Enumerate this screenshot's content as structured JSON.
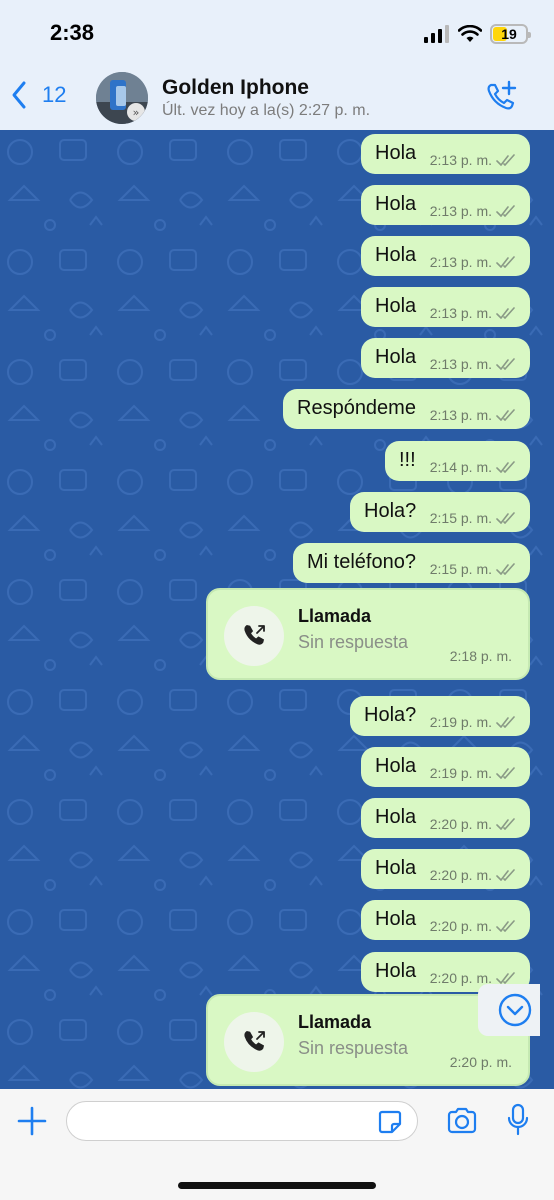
{
  "status_bar": {
    "time": "2:38",
    "battery": "19",
    "icons": [
      "signal-icon",
      "wifi-icon",
      "battery-icon"
    ]
  },
  "header": {
    "back_count": "12",
    "contact_name": "Golden Iphone",
    "contact_status": "Últ. vez hoy a la(s) 2:27 p. m.",
    "accent_color": "#1e7ef0"
  },
  "messages": [
    {
      "text": "Hola",
      "time": "2:13 p. m."
    },
    {
      "text": "Hola",
      "time": "2:13 p. m."
    },
    {
      "text": "Hola",
      "time": "2:13 p. m."
    },
    {
      "text": "Hola",
      "time": "2:13 p. m."
    },
    {
      "text": "Hola",
      "time": "2:13 p. m."
    },
    {
      "text": "Respóndeme",
      "time": "2:13 p. m."
    },
    {
      "text": "!!!",
      "time": "2:14 p. m."
    },
    {
      "text": "Hola?",
      "time": "2:15 p. m."
    },
    {
      "text": "Mi teléfono?",
      "time": "2:15 p. m."
    },
    {
      "call": true,
      "title": "Llamada",
      "subtitle": "Sin respuesta",
      "time": "2:18 p. m."
    },
    {
      "text": "Hola?",
      "time": "2:19 p. m."
    },
    {
      "text": "Hola",
      "time": "2:19 p. m."
    },
    {
      "text": "Hola",
      "time": "2:20 p. m."
    },
    {
      "text": "Hola",
      "time": "2:20 p. m."
    },
    {
      "text": "Hola",
      "time": "2:20 p. m."
    },
    {
      "text": "Hola",
      "time": "2:20 p. m."
    },
    {
      "call": true,
      "title": "Llamada",
      "subtitle": "Sin respuesta",
      "time": "2:20 p. m."
    }
  ],
  "colors": {
    "chat_background": "#2a5ba4",
    "outgoing_bubble": "#d9f8c4"
  },
  "input_bar": {
    "placeholder": "",
    "icons": [
      "plus-icon",
      "sticker-icon",
      "camera-icon",
      "microphone-icon"
    ]
  }
}
